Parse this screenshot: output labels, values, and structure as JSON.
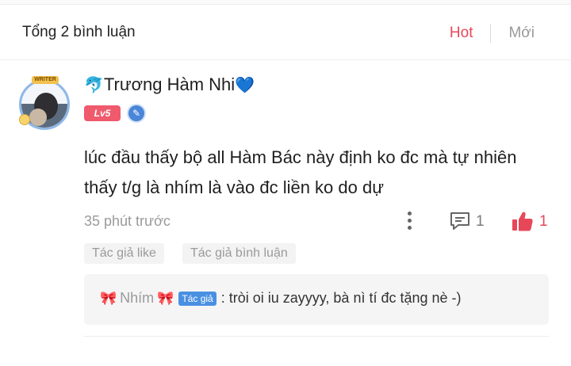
{
  "header": {
    "comment_count": "Tổng 2 bình luận",
    "sort_hot": "Hot",
    "sort_new": "Mới"
  },
  "comment": {
    "username": "Trương Hàm Nhi",
    "name_prefix_emoji": "🐬",
    "name_suffix_emoji": "💙",
    "level": "Lv5",
    "avatar_frame_label": "WRITER",
    "text": "lúc đầu thấy bộ all Hàm Bác này định ko đc mà tự nhiên thấy t/g là nhím là vào đc liền ko do dự",
    "time": "35 phút trước",
    "reply_count": "1",
    "like_count": "1",
    "tags": [
      "Tác giả like",
      "Tác giả bình luận"
    ]
  },
  "reply": {
    "name": "Nhím",
    "bow_emoji": "🎀",
    "author_tag": "Tác giả",
    "text": ": tròi oi iu zayyyy, bà nì tí đc tặng nè -)"
  },
  "colors": {
    "accent": "#e8475a",
    "muted": "#9a9a9a",
    "author_tag": "#4a90e2",
    "level_badge": "#ef5a6d"
  },
  "icons": [
    "more-vertical-icon",
    "comment-icon",
    "thumbs-up-icon",
    "author-shield-icon"
  ]
}
